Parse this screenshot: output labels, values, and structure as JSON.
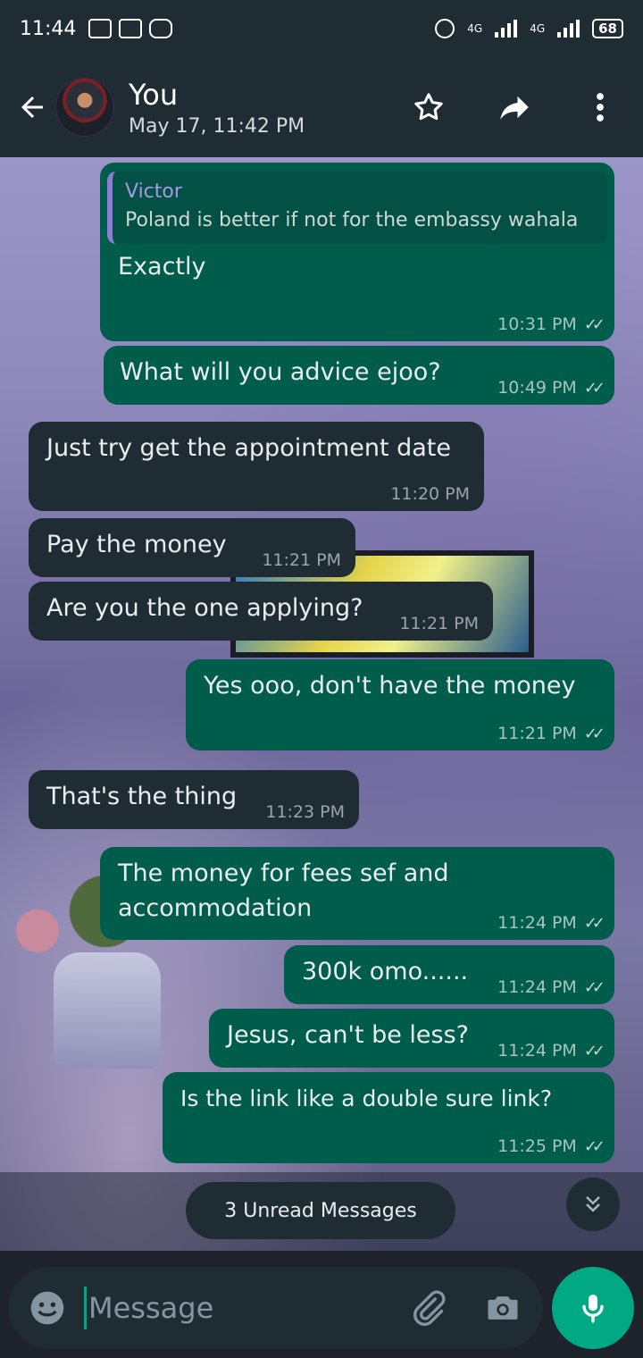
{
  "status_bar": {
    "time": "11:44",
    "battery": "68",
    "network_labels": [
      "4G",
      "4G"
    ]
  },
  "header": {
    "title": "You",
    "subtitle": "May 17, 11:42 PM",
    "icons": [
      "back-arrow-icon",
      "avatar",
      "star-icon",
      "forward-icon",
      "more-vert-icon"
    ]
  },
  "messages": [
    {
      "direction": "outgoing",
      "quote": {
        "author": "Victor",
        "text": "Poland is better if not for the embassy wahala"
      },
      "text": "Exactly",
      "time": "10:31 PM",
      "status": "read"
    },
    {
      "direction": "outgoing",
      "text": "What will you advice ejoo?",
      "time": "10:49 PM",
      "status": "read"
    },
    {
      "direction": "incoming",
      "text": "Just try get the appointment date",
      "time": "11:20 PM"
    },
    {
      "direction": "incoming",
      "text": "Pay the money",
      "time": "11:21 PM"
    },
    {
      "direction": "incoming",
      "text": "Are you the one applying?",
      "time": "11:21 PM"
    },
    {
      "direction": "outgoing",
      "text": "Yes ooo, don't have the money",
      "time": "11:21 PM",
      "status": "read"
    },
    {
      "direction": "incoming",
      "text": "That's the thing",
      "time": "11:23 PM"
    },
    {
      "direction": "outgoing",
      "text": "The money for fees sef and accommodation",
      "time": "11:24 PM",
      "status": "read"
    },
    {
      "direction": "outgoing",
      "text": "300k omo......",
      "time": "11:24 PM",
      "status": "read"
    },
    {
      "direction": "outgoing",
      "text": "Jesus, can't be less?",
      "time": "11:24 PM",
      "status": "read"
    },
    {
      "direction": "outgoing",
      "text": "Is the link like a double sure link?",
      "time": "11:25 PM",
      "status": "read"
    }
  ],
  "unread": {
    "label": "3 Unread Messages"
  },
  "composer": {
    "placeholder": "Message"
  },
  "colors": {
    "header_bg": "#1f2c34",
    "outgoing_bubble": "#005c4b",
    "incoming_bubble": "#202c33",
    "accent": "#00a884",
    "quote_bar": "#8f7cd6"
  }
}
